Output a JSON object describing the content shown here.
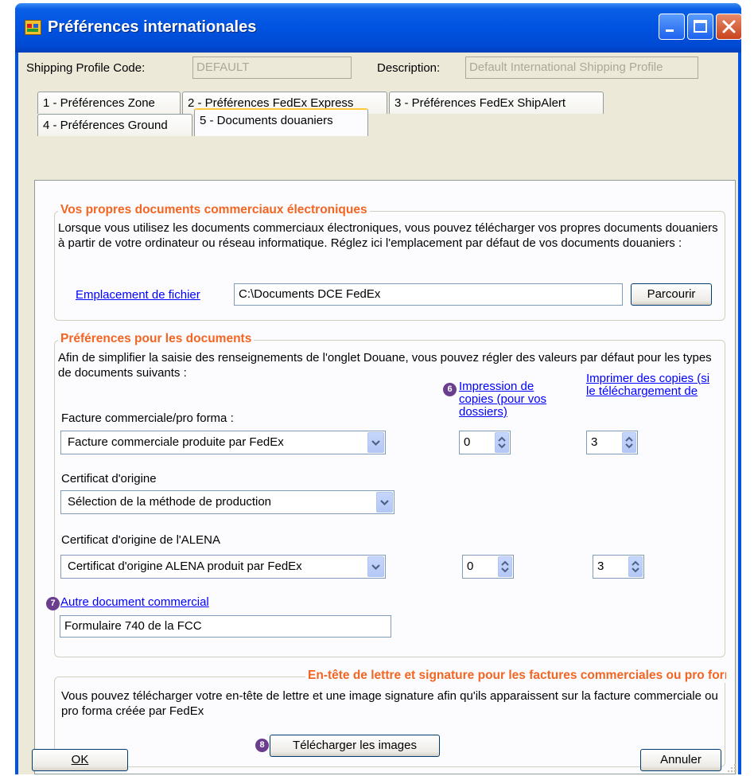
{
  "window": {
    "title": "Préférences internationales"
  },
  "header": {
    "profile_code_label": "Shipping Profile Code:",
    "profile_code_value": "DEFAULT",
    "description_label": "Description:",
    "description_value": "Default International Shipping Profile"
  },
  "tabs": [
    {
      "label": "1 - Préférences Zone"
    },
    {
      "label": "2 - Préférences FedEx Express"
    },
    {
      "label": "3 - Préférences FedEx ShipAlert"
    },
    {
      "label": "4 - Préférences Ground"
    },
    {
      "label": "5 - Documents douaniers",
      "active": true
    }
  ],
  "group1": {
    "title": "Vos propres documents commerciaux électroniques",
    "text": "Lorsque vous utilisez les documents commerciaux électroniques, vous pouvez télécharger vos propres documents douaniers à partir de votre ordinateur ou réseau informatique.  Réglez ici l'emplacement par défaut de vos documents douaniers :",
    "file_location_link": "Emplacement de fichier",
    "file_location_value": "C:\\Documents DCE FedEx",
    "browse_button": "Parcourir"
  },
  "group2": {
    "title": "Préférences pour les documents",
    "text": "Afin de simplifier la saisie des renseignements de l'onglet Douane, vous pouvez régler des valeurs par défaut pour les types de documents suivants :",
    "col_print_copies": "Impression de copies (pour vos dossiers)",
    "col_print_upload": "Imprimer des copies (si le téléchargement de",
    "invoice_label": "Facture commerciale/pro forma :",
    "invoice_select": "Facture commerciale produite par FedEx",
    "invoice_copies": "0",
    "invoice_upload_copies": "3",
    "origin_label": "Certificat d'origine",
    "origin_select": "Sélection de la méthode de production",
    "nafta_label": "Certificat d'origine de l'ALENA",
    "nafta_select": "Certificat d'origine ALENA produit par FedEx",
    "nafta_copies": "0",
    "nafta_upload_copies": "3",
    "other_doc_link": "Autre document commercial",
    "other_doc_value": "Formulaire 740 de la FCC"
  },
  "group3": {
    "title": "En-tête de lettre et signature pour les factures commerciales ou pro forma créées par",
    "text": "Vous pouvez télécharger votre en-tête de lettre et une image signature afin qu'ils apparaissent sur la facture commerciale ou pro forma créée par FedEx",
    "upload_button": "Télécharger les images"
  },
  "badges": {
    "b6": "6",
    "b7": "7",
    "b8": "8"
  },
  "footer": {
    "ok_button": "OK",
    "cancel_button": "Annuler"
  },
  "colors": {
    "title_bar": "#0054e3",
    "group_title": "#f26522",
    "link": "#0000ff",
    "badge": "#6a3d8e",
    "face": "#ece9d8"
  }
}
